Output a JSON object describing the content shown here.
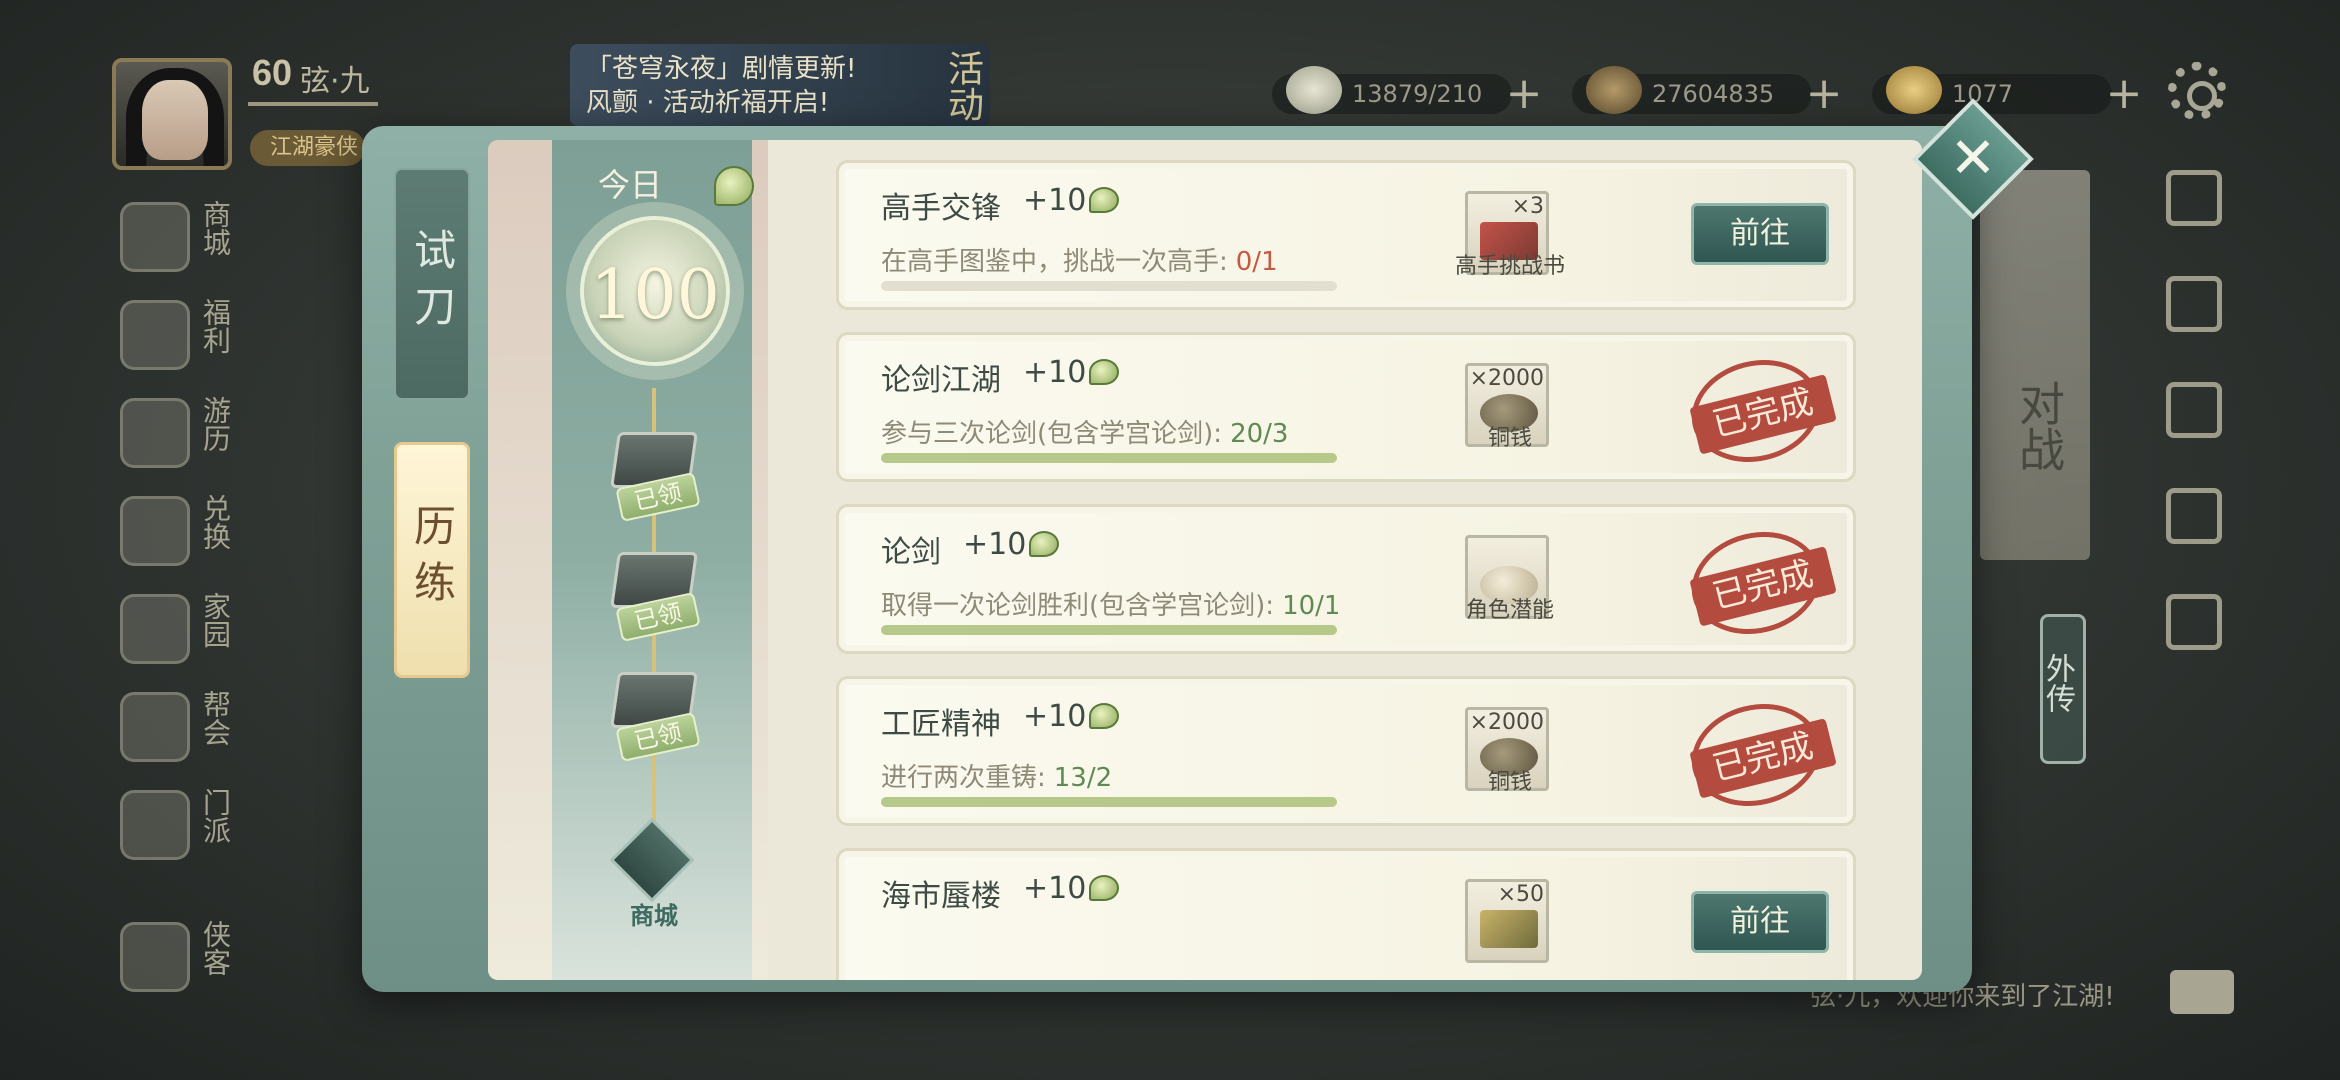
{
  "hud": {
    "level": "60",
    "player_name": "弦·九",
    "title_tag": "江湖豪侠",
    "banner_line1": "「苍穹永夜」剧情更新!",
    "banner_line2": "风颤 · 活动祈福开启!",
    "banner_badge": "活动",
    "resources": [
      {
        "name": "buns",
        "value": "13879/210"
      },
      {
        "name": "coins",
        "value": "27604835"
      },
      {
        "name": "ingots",
        "value": "1077"
      }
    ],
    "plus": "+"
  },
  "left_nav": [
    {
      "label": "商城",
      "icon": "shop-icon"
    },
    {
      "label": "福利",
      "icon": "welfare-icon"
    },
    {
      "label": "游历",
      "icon": "travel-icon"
    },
    {
      "label": "兑换",
      "icon": "exchange-icon"
    },
    {
      "label": "家园",
      "icon": "home-icon"
    },
    {
      "label": "帮会",
      "icon": "guild-icon"
    },
    {
      "label": "门派",
      "icon": "sect-icon"
    },
    {
      "label": "侠客",
      "icon": "hero-icon"
    }
  ],
  "right_side": {
    "duizhan": "对战",
    "waizhuan": "外传"
  },
  "chat_message": "弦·九，欢迎你来到了江湖!",
  "dialog": {
    "tabs": {
      "trial": "试刀",
      "training": "历练"
    },
    "today_label": "今日",
    "today_score": "100",
    "claimed_label": "已领",
    "shop_label": "商城",
    "close": "✕",
    "done_label": "已完成",
    "go_label": "前往",
    "tasks": [
      {
        "title": "高手交锋",
        "points": "+10",
        "desc": "在高手图鉴中，挑战一次高手:",
        "progress": "0/1",
        "progress_color": "red",
        "progress_fraction": 0.0,
        "item_qty": "×3",
        "item_name": "高手挑战书",
        "state": "go"
      },
      {
        "title": "论剑江湖",
        "points": "+10",
        "desc": "参与三次论剑(包含学宫论剑):",
        "progress": "20/3",
        "progress_color": "green",
        "progress_fraction": 1.0,
        "item_qty": "×2000",
        "item_name": "铜钱",
        "state": "done"
      },
      {
        "title": "论剑",
        "points": "+10",
        "desc": "取得一次论剑胜利(包含学宫论剑):",
        "progress": "10/1",
        "progress_color": "green",
        "progress_fraction": 1.0,
        "item_qty": "",
        "item_name": "角色潜能",
        "state": "done"
      },
      {
        "title": "工匠精神",
        "points": "+10",
        "desc": "进行两次重铸:",
        "progress": "13/2",
        "progress_color": "green",
        "progress_fraction": 1.0,
        "item_qty": "×2000",
        "item_name": "铜钱",
        "state": "done"
      },
      {
        "title": "海市蜃楼",
        "points": "+10",
        "desc": "",
        "progress": "",
        "progress_color": "green",
        "progress_fraction": 0.0,
        "item_qty": "×50",
        "item_name": "",
        "state": "go"
      }
    ]
  }
}
